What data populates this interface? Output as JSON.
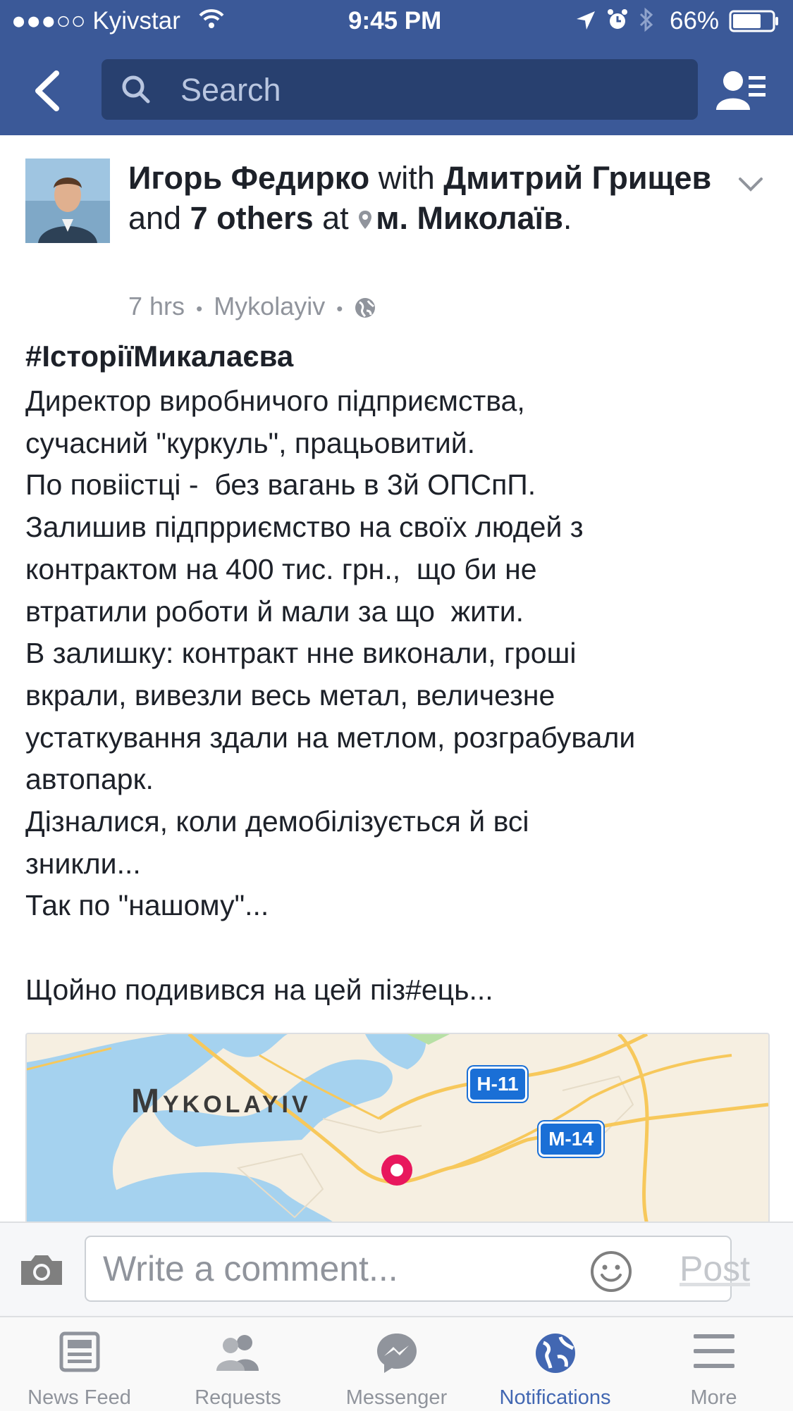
{
  "status_bar": {
    "carrier": "●●●○○ Kyivstar",
    "time": "9:45 PM",
    "battery": "66%"
  },
  "header": {
    "search_placeholder": "Search",
    "back_icon": "chevron-left-icon",
    "friends_icon": "friend-list-icon"
  },
  "post": {
    "author": "Игорь Федирко",
    "with_word": " with ",
    "tagged_first": "Дмитрий Грищев",
    "and_word": " and ",
    "others": "7 others",
    "at_word": " at ",
    "place": "м. Миколаїв",
    "period": ".",
    "time": "7 hrs",
    "dot": "•",
    "location": "Mykolayiv",
    "hashtag": "#ІсторіїМикалаєва",
    "body": "Директор виробничого підприємства,\nсучасний \"куркуль\", працьовитий.\nПо повіістці -  без вагань в 3й ОПСпП.\nЗалишив підпрриємство на своїх людей з\nконтрактом на 400 тис. грн.,  що би не\nвтратили роботи й мали за що  жити.\nВ залишку: контракт нне виконали, гроші\nвкрали, вивезли весь метал, величезне\nустаткування здали на метлом, розграбували\nавтопарк.\nДізналися, коли демобілізується й всі\nзникли...\nТак по \"нашому\"...\n\nЩойно подивився на цей піз#ець..."
  },
  "map": {
    "city_label": "Mykolayiv",
    "road_h11": "H-11",
    "road_m14": "M-14",
    "pin_color": "#e8175d",
    "water_color": "#a5d2ef",
    "land_color": "#f6efe1",
    "road_color": "#f7c85b"
  },
  "comment": {
    "placeholder": "Write a comment...",
    "post_label": "Post"
  },
  "tabs": [
    {
      "label": "News Feed",
      "icon": "news-feed-icon",
      "active": false
    },
    {
      "label": "Requests",
      "icon": "friend-requests-icon",
      "active": false
    },
    {
      "label": "Messenger",
      "icon": "messenger-icon",
      "active": false
    },
    {
      "label": "Notifications",
      "icon": "globe-icon",
      "active": true
    },
    {
      "label": "More",
      "icon": "menu-icon",
      "active": false
    }
  ],
  "colors": {
    "brand": "#3b5998",
    "active_tab": "#4267b2",
    "meta": "#90949c"
  }
}
